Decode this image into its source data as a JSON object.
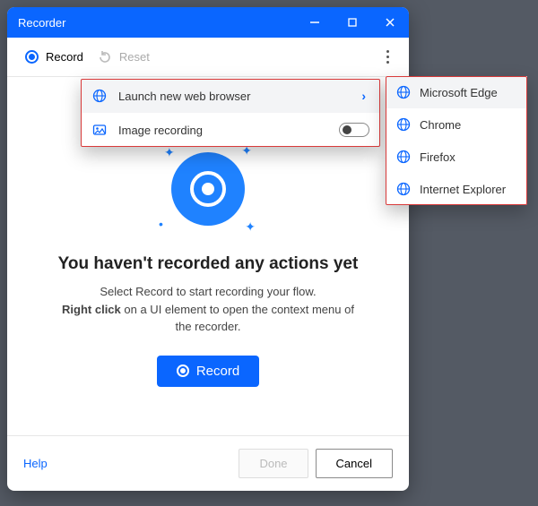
{
  "window": {
    "title": "Recorder"
  },
  "toolbar": {
    "record_label": "Record",
    "reset_label": "Reset"
  },
  "dropdown": {
    "launch_browser_label": "Launch new web browser",
    "image_recording_label": "Image recording"
  },
  "browsers": [
    {
      "name": "Microsoft Edge"
    },
    {
      "name": "Chrome"
    },
    {
      "name": "Firefox"
    },
    {
      "name": "Internet Explorer"
    }
  ],
  "empty_state": {
    "heading": "You haven't recorded any actions yet",
    "line1": "Select Record to start recording your flow.",
    "bold": "Right click",
    "line2_rest": " on a UI element to open the context menu of the recorder."
  },
  "record_button_label": "Record",
  "footer": {
    "help_label": "Help",
    "done_label": "Done",
    "cancel_label": "Cancel"
  }
}
